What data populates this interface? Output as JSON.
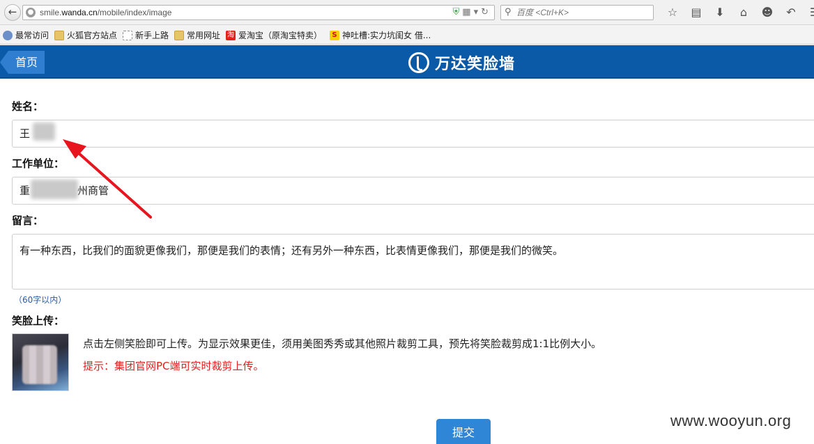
{
  "browser": {
    "url_prefix": "smile.",
    "url_domain": "wanda.cn",
    "url_path": "/mobile/index/image",
    "search_placeholder": "百度 <Ctrl+K>",
    "bookmarks": [
      {
        "label": "最常访问",
        "icon": "star"
      },
      {
        "label": "火狐官方站点",
        "icon": "folder"
      },
      {
        "label": "新手上路",
        "icon": "page"
      },
      {
        "label": "常用网址",
        "icon": "folder"
      },
      {
        "label": "爱淘宝（原淘宝特卖）",
        "icon": "tao"
      },
      {
        "label": "神吐槽:实力坑闺女 借...",
        "icon": "shen"
      }
    ]
  },
  "header": {
    "home_label": "首页",
    "logo_text": "万达笑脸墙"
  },
  "form": {
    "name_label": "姓名：",
    "name_value": "王",
    "company_label": "工作单位：",
    "company_value_prefix": "重",
    "company_value_suffix": "州商管",
    "message_label": "留言：",
    "message_value": "有一种东西，比我们的面貌更像我们，那便是我们的表情；还有另外一种东西，比表情更像我们，那便是我们的微笑。",
    "message_hint": "（60字以内）",
    "upload_label": "笑脸上传：",
    "upload_desc": "点击左侧笑脸即可上传。为显示效果更佳，须用美图秀秀或其他照片裁剪工具，预先将笑脸裁剪成1:1比例大小。",
    "upload_tip": "提示：集团官网PC端可实时裁剪上传。",
    "submit_label": "提交"
  },
  "watermark": "www.wooyun.org",
  "colors": {
    "header_bg": "#0a5aa8",
    "home_button": "#2f7ed0",
    "tip_red": "#e02020",
    "annotation_arrow": "#e8141e",
    "submit_bg": "#2f86d6"
  }
}
